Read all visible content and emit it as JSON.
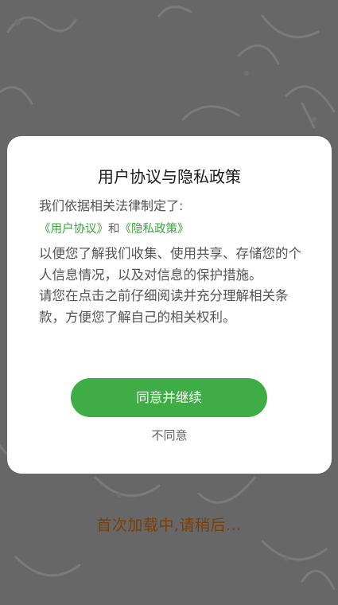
{
  "background": {
    "loading_text": "首次加载中,请稍后..."
  },
  "dialog": {
    "title": "用户协议与隐私政策",
    "intro": "我们依据相关法律制定了:",
    "user_agreement_link": "《用户协议》",
    "and_text": "和",
    "privacy_policy_link": "《隐私政策》",
    "paragraph1": "以便您了解我们收集、使用共享、存储您的个人信息情况，以及对信息的保护措施。",
    "paragraph2": "请您在点击之前仔细阅读并充分理解相关条款，方便您了解自己的相关权利。",
    "agree_button": "同意并继续",
    "disagree_button": "不同意"
  },
  "colors": {
    "accent": "#3fad46",
    "link": "#3aa43f",
    "overlay": "#676767",
    "loading_text": "#7a3f06"
  }
}
